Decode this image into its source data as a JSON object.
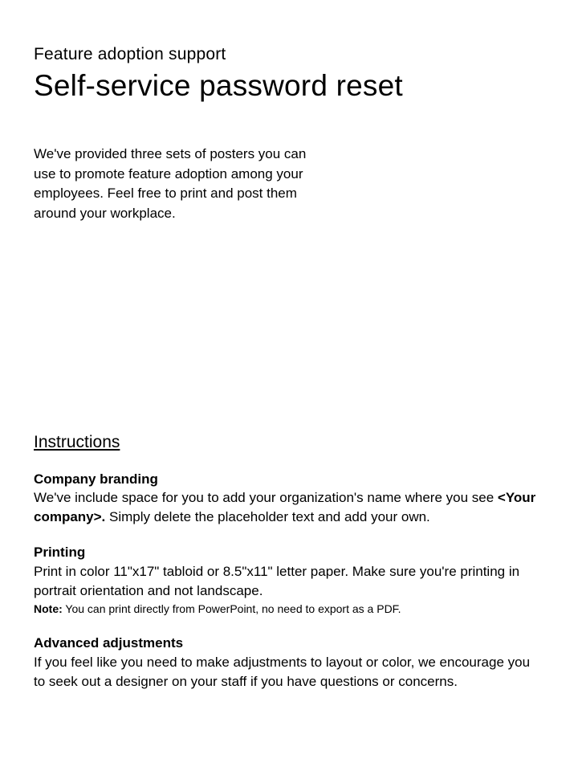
{
  "overline": "Feature adoption support",
  "title": "Self-service password reset",
  "intro": "We've provided three sets of posters you can use to promote feature adoption among your employees. Feel free to print and post them around your workplace.",
  "instructions_heading": "Instructions",
  "sections": {
    "branding": {
      "heading": "Company branding",
      "body_pre": "We've include space for you to add your organization's name where you see ",
      "placeholder": "<Your company>.",
      "body_post": " Simply delete the placeholder text and add your own."
    },
    "printing": {
      "heading": "Printing",
      "body": "Print in color 11\"x17\" tabloid or 8.5\"x11\" letter paper. Make sure you're printing in portrait orientation and not landscape.",
      "note_label": "Note:",
      "note_body": " You can print directly from PowerPoint, no need to export as a PDF."
    },
    "advanced": {
      "heading": "Advanced adjustments",
      "body": "If you feel like you need to make adjustments to layout or color, we encourage you to seek out a designer on your staff if you have questions or concerns."
    }
  }
}
